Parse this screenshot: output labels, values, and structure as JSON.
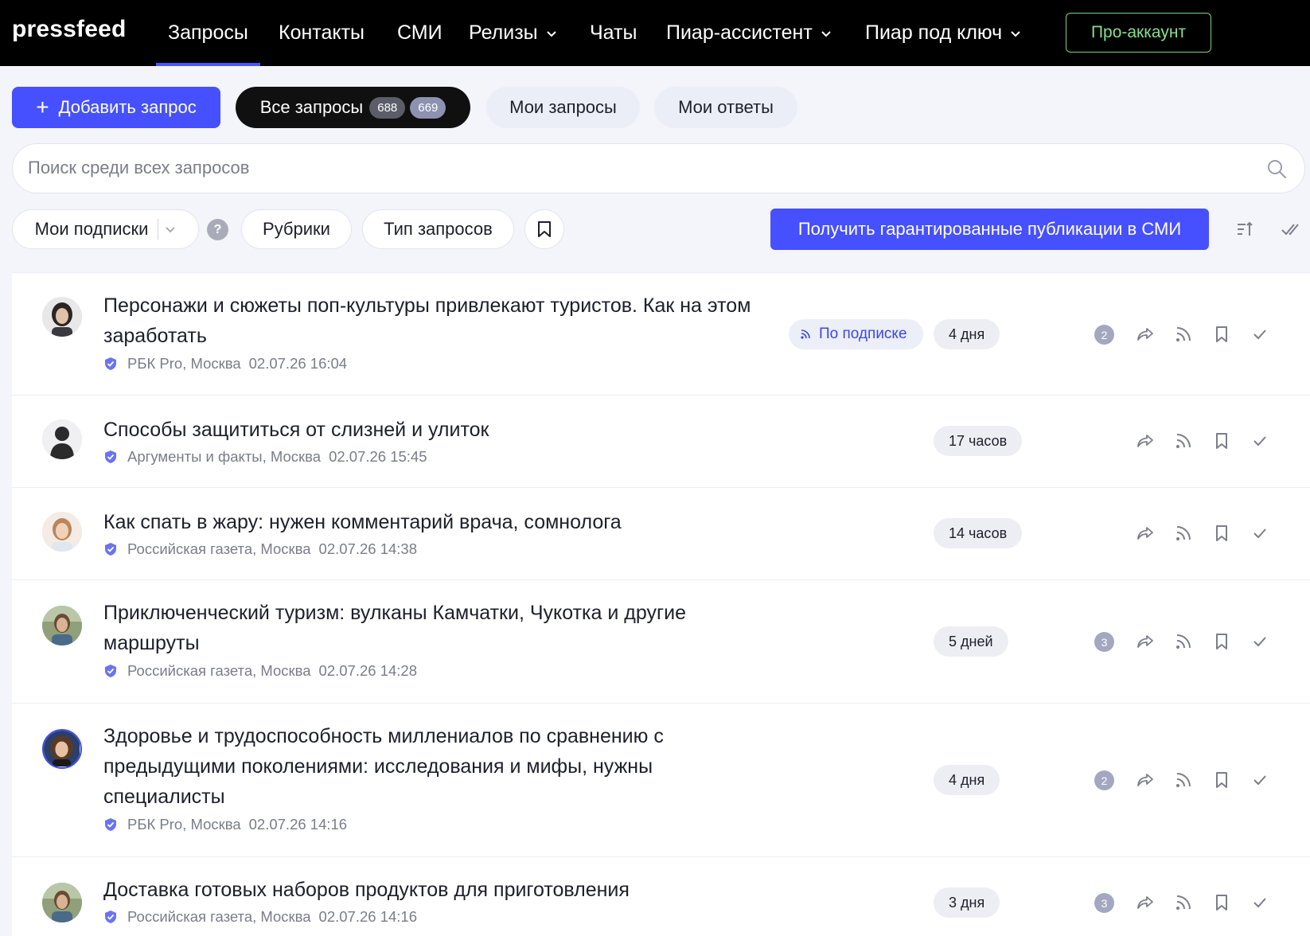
{
  "nav": {
    "logo": "pressfeed",
    "items": [
      {
        "label": "Запросы",
        "active": true,
        "dropdown": false
      },
      {
        "label": "Контакты",
        "active": false,
        "dropdown": false
      },
      {
        "label": "СМИ",
        "active": false,
        "dropdown": false
      },
      {
        "label": "Релизы",
        "active": false,
        "dropdown": true
      },
      {
        "label": "Чаты",
        "active": false,
        "dropdown": false
      },
      {
        "label": "Пиар-ассистент",
        "active": false,
        "dropdown": true
      },
      {
        "label": "Пиар под ключ",
        "active": false,
        "dropdown": true
      }
    ],
    "pro_label": "Про-аккаунт"
  },
  "tabs": {
    "add_label": "Добавить запрос",
    "all_label": "Все запросы",
    "all_count_1": "688",
    "all_count_2": "669",
    "mine_label": "Мои запросы",
    "answers_label": "Мои ответы"
  },
  "search": {
    "placeholder": "Поиск среди всех запросов",
    "value": ""
  },
  "filters": {
    "subscriptions": "Мои подписки",
    "help": "?",
    "rubrics": "Рубрики",
    "request_type": "Тип запросов",
    "guarantee_label": "Получить гарантированные публикации в СМИ"
  },
  "requests": [
    {
      "title": "Персонажи и сюжеты поп-культуры привлекают туристов. Как на этом заработать",
      "source": "РБК Pro, Москва",
      "date": "02.07.26 16:04",
      "subscription": "По подписке",
      "deadline": "4 дня",
      "answers": "2",
      "avatar": "woman-dark-hair"
    },
    {
      "title": "Способы защититься от слизней и улиток",
      "source": "Аргументы и факты, Москва",
      "date": "02.07.26 15:45",
      "subscription": "",
      "deadline": "17 часов",
      "answers": "",
      "avatar": "silhouette"
    },
    {
      "title": "Как спать в жару: нужен комментарий врача, сомнолога",
      "source": "Российская газета, Москва",
      "date": "02.07.26 14:38",
      "subscription": "",
      "deadline": "14 часов",
      "answers": "",
      "avatar": "woman-light-hair"
    },
    {
      "title": "Приключенческий туризм: вулканы Камчатки, Чукотка и другие маршруты",
      "source": "Российская газета, Москва",
      "date": "02.07.26 14:28",
      "subscription": "",
      "deadline": "5 дней",
      "answers": "3",
      "avatar": "woman-outdoor"
    },
    {
      "title": "Здоровье и трудоспособность миллениалов по сравнению с предыдущими поколениями: исследования и мифы, нужны специалисты",
      "source": "РБК Pro, Москва",
      "date": "02.07.26 14:16",
      "subscription": "",
      "deadline": "4 дня",
      "answers": "2",
      "avatar": "woman-curly-hair"
    },
    {
      "title": "Доставка готовых наборов продуктов для приготовления",
      "source": "Российская газета, Москва",
      "date": "02.07.26 14:16",
      "subscription": "",
      "deadline": "3 дня",
      "answers": "3",
      "avatar": "woman-outdoor"
    }
  ],
  "colors": {
    "accent": "#4650ff",
    "nav_bg": "#000000",
    "pro_green": "#86e08a",
    "page_bg": "#f4f5fa",
    "verified": "#6a74f0"
  },
  "icons": [
    "plus-icon",
    "search-icon",
    "chevron-down-icon",
    "bookmark-icon",
    "sort-icon",
    "mark-all-read-icon",
    "rss-icon",
    "share-icon",
    "check-icon",
    "verified-shield-icon"
  ]
}
